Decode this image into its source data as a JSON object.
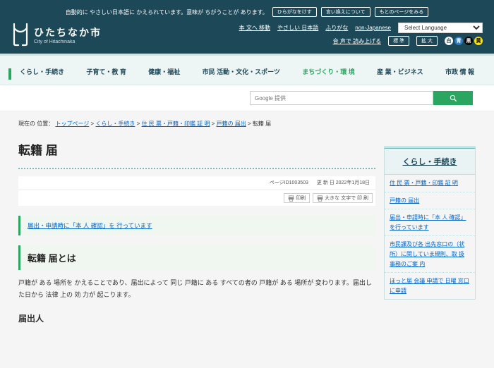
{
  "announce": {
    "text": "自動的に やさしい日本語に かえられています。意味が ちがうことが あります。",
    "btn1": "ひらがなをけす",
    "btn2": "言い換えについて",
    "btn3": "もとのページをみる"
  },
  "site": {
    "jp": "ひたちなか市",
    "en": "City of Hitachinaka"
  },
  "hdr_links": {
    "l1": "本 文へ 移動",
    "l2": "やさしい 日本語",
    "l3": "ふりがな",
    "l4": "non-Japanese",
    "sel": "Select Language"
  },
  "hdr_sub": {
    "l1": "音 声で 読み上げる",
    "l2": "標 準",
    "l3": "拡 大"
  },
  "cats": [
    {
      "main": "くらし・手続き",
      "active": true
    },
    {
      "main": "子育て・教 育"
    },
    {
      "main": "健康・福祉"
    },
    {
      "main": "市民 活動・文化・スポーツ"
    },
    {
      "main": "まちづくり・環 境",
      "green": true
    },
    {
      "main": "産 業・ビジネス"
    },
    {
      "main": "市政 情 報"
    }
  ],
  "search": {
    "placeholder": "Google 提供"
  },
  "crumb": {
    "label": "現在の 位置：",
    "items": [
      "トップページ",
      "くらし・手続き",
      "住 民 票・戸籍・印鑑 証 明",
      "戸籍の 届出"
    ],
    "last": "転籍 届"
  },
  "title": "転籍 届",
  "meta": {
    "pid": "ページID1003503",
    "date": "更 新 日 2022年1月18日",
    "print": "印刷",
    "bigprint": "大きな 文字で 印 刷"
  },
  "notice": "届出・申請時に「本 人 確認」を 行っています",
  "sec1": "転籍 届とは",
  "body1": "戸籍が ある 場所を かえることであり、届出によって 同じ 戸籍に ある すべての者の 戸籍が ある 場所が 変わります。届出した日から 法律 上の 効 力が 起こります。",
  "sub1": "届出人",
  "side": {
    "title": "くらし・手続き",
    "items": [
      "住 民 票・戸籍・印鑑 証 明",
      "戸籍の 届出",
      "届出・申請時に「本 人 確認」を行っています",
      "市民課及び各 出先窓口の（状 所）に関していま規則、取 扱 事務のご案 内",
      "ほっと届 会議 申請で 日曜 窓口に申請"
    ]
  }
}
